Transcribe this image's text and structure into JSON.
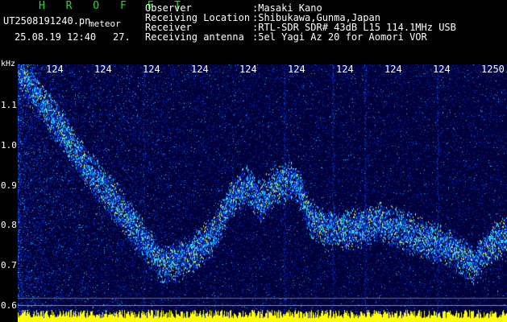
{
  "header": {
    "brand": "H R O F F T",
    "brand_color": "#22dd22",
    "file_name": "UT2508191240.pn",
    "file_note": "meteor",
    "date_time": "25.08.19 12:40",
    "display_value": "27."
  },
  "info": [
    {
      "label": "Observer",
      "value": ":Masaki Kano"
    },
    {
      "label": "Receiving Location",
      "value": ":Shibukawa,Gunma,Japan"
    },
    {
      "label": "Receiver",
      "value": ":RTL-SDR SDR# 43dB L15 114.1MHz USB"
    },
    {
      "label": "Receiving antenna",
      "value": ":5el Yagi Az 20 for Aomori VOR"
    }
  ],
  "axis": {
    "unit": "kHz",
    "y_ticks": [
      "1.1",
      "1.0",
      "0.9",
      "0.8",
      "0.7",
      "0.6"
    ],
    "time_ticks": [
      "124",
      "124",
      "124",
      "124",
      "124",
      "124",
      "124",
      "124",
      "124",
      "1250"
    ]
  },
  "spectrogram": {
    "background_color": "#00003a",
    "noise_color": "#0a3ce0",
    "signal_color": "#20d0ff",
    "peak_color": "#e8e83a",
    "baseline_color": "#ffff00"
  }
}
